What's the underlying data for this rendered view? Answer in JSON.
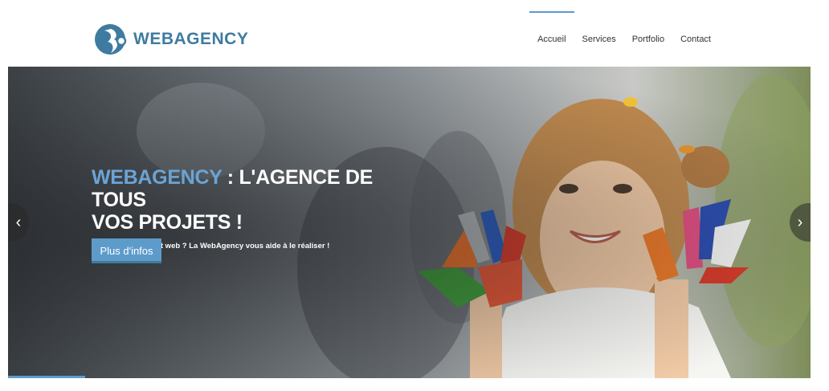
{
  "brand": {
    "name": "WEBAGENCY",
    "logo_icon": "webagency-logo-icon",
    "color": "#3f7ba0"
  },
  "nav": {
    "items": [
      {
        "label": "Accueil",
        "active": true
      },
      {
        "label": "Services",
        "active": false
      },
      {
        "label": "Portfolio",
        "active": false
      },
      {
        "label": "Contact",
        "active": false
      }
    ]
  },
  "hero": {
    "title_accent": "WEBAGENCY",
    "title_rest": " : L'AGENCE DE TOUS",
    "title_line2": "VOS PROJETS !",
    "subtitle": "Vous avez un projet web ? La WebAgency vous aide à le réaliser !",
    "button_label": "Plus d'infos",
    "prev_icon": "chevron-left-icon",
    "next_icon": "chevron-right-icon",
    "prev_glyph": "‹",
    "next_glyph": "›",
    "accent_color": "#6aa4d6",
    "button_color": "#5d9bcb"
  }
}
